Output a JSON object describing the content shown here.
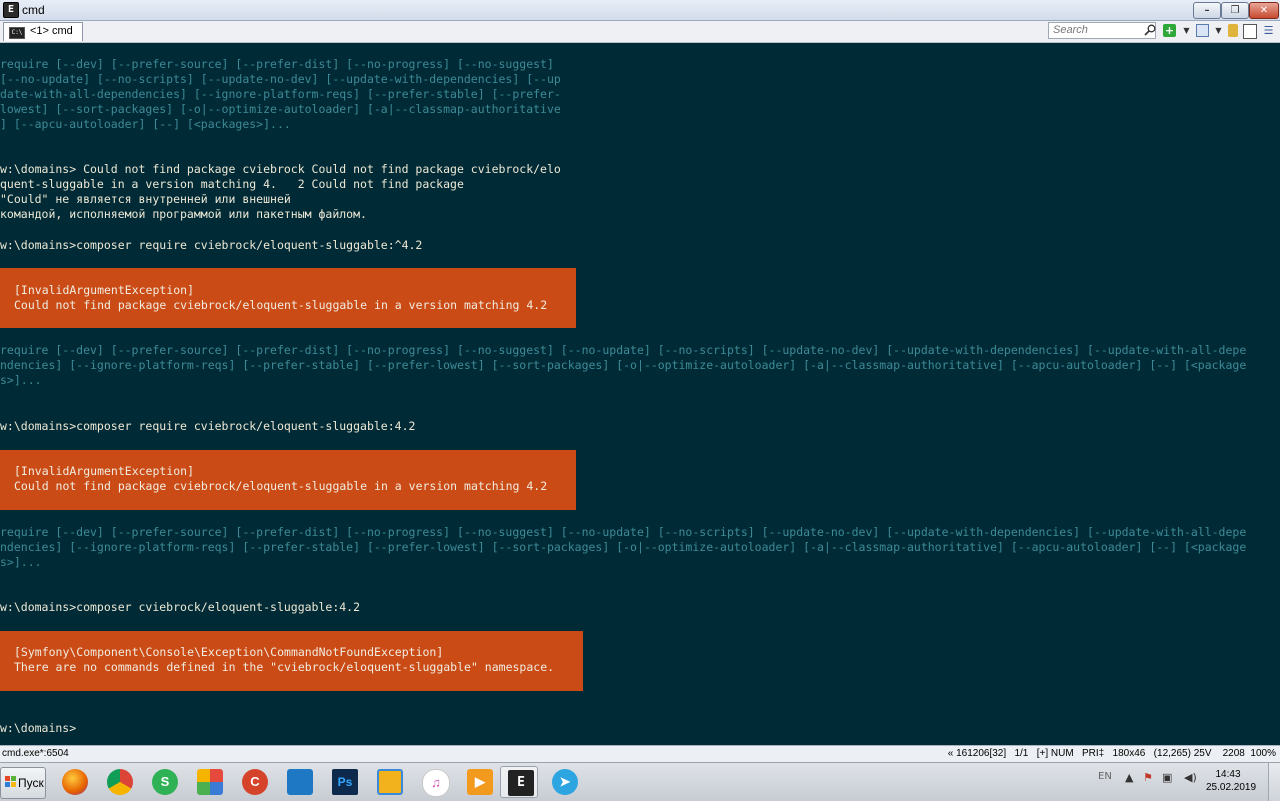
{
  "window": {
    "title": "cmd",
    "app_icon": "E",
    "minimize": "–",
    "maximize": "❐",
    "close": "✕"
  },
  "tabbar": {
    "tab_label": "<1> cmd",
    "search_placeholder": "Search",
    "search_icon": "magnifier-icon"
  },
  "console": {
    "lines": [
      {
        "text": "require [--dev] [--prefer-source] [--prefer-dist] [--no-progress] [--no-suggest]",
        "style": "help"
      },
      {
        "text": "[--no-update] [--no-scripts] [--update-no-dev] [--update-with-dependencies] [--up",
        "style": "help"
      },
      {
        "text": "date-with-all-dependencies] [--ignore-platform-reqs] [--prefer-stable] [--prefer-",
        "style": "help"
      },
      {
        "text": "lowest] [--sort-packages] [-o|--optimize-autoloader] [-a|--classmap-authoritative",
        "style": "help"
      },
      {
        "text": "] [--apcu-autoloader] [--] [<packages>]...",
        "style": "help"
      },
      {
        "text": "w:\\domains> Could not find package cviebrock Could not find package cviebrock/elo",
        "style": "normal"
      },
      {
        "text": "quent-sluggable in a version matching 4.   2 Could not find package",
        "style": "normal"
      },
      {
        "text": "\"Could\" не является внутренней или внешней",
        "style": "normal"
      },
      {
        "text": "командой, исполняемой программой или пакетным файлом.",
        "style": "normal"
      },
      {
        "text": "w:\\domains>composer require cviebrock/eloquent-sluggable:^4.2",
        "style": "normal"
      },
      {
        "text": "require [--dev] [--prefer-source] [--prefer-dist] [--no-progress] [--no-suggest] [--no-update] [--no-scripts] [--update-no-dev] [--update-with-dependencies] [--update-with-all-depe",
        "style": "help"
      },
      {
        "text": "ndencies] [--ignore-platform-reqs] [--prefer-stable] [--prefer-lowest] [--sort-packages] [-o|--optimize-autoloader] [-a|--classmap-authoritative] [--apcu-autoloader] [--] [<package",
        "style": "help"
      },
      {
        "text": "s>]...",
        "style": "help"
      },
      {
        "text": "w:\\domains>composer require cviebrock/eloquent-sluggable:4.2",
        "style": "normal"
      },
      {
        "text": "require [--dev] [--prefer-source] [--prefer-dist] [--no-progress] [--no-suggest] [--no-update] [--no-scripts] [--update-no-dev] [--update-with-dependencies] [--update-with-all-depe",
        "style": "help"
      },
      {
        "text": "ndencies] [--ignore-platform-reqs] [--prefer-stable] [--prefer-lowest] [--sort-packages] [-o|--optimize-autoloader] [-a|--classmap-authoritative] [--apcu-autoloader] [--] [<package",
        "style": "help"
      },
      {
        "text": "s>]...",
        "style": "help"
      },
      {
        "text": "w:\\domains>composer cviebrock/eloquent-sluggable:4.2",
        "style": "normal"
      },
      {
        "text": "w:\\domains>",
        "style": "normal"
      }
    ],
    "errors": [
      {
        "title": "[InvalidArgumentException]",
        "message": "Could not find package cviebrock/eloquent-sluggable in a version matching 4.2"
      },
      {
        "title": "[InvalidArgumentException]",
        "message": "Could not find package cviebrock/eloquent-sluggable in a version matching 4.2"
      },
      {
        "title": "[Symfony\\Component\\Console\\Exception\\CommandNotFoundException]",
        "message": "There are no commands defined in the \"cviebrock/eloquent-sluggable\" namespace."
      }
    ],
    "colors": {
      "background": "#002b36",
      "text": "#eee8d5",
      "help_text": "#3d8a96",
      "error_bg": "#cb4b16"
    }
  },
  "statusbar": {
    "process": "cmd.exe*:6504",
    "info": "« 161206[32]   1/1   [+] NUM   PRI‡   180x46   (12,265) 25V    2208  100%"
  },
  "taskbar": {
    "start_label": "Пуск",
    "apps": [
      {
        "name": "firefox-icon",
        "glyph": "",
        "color": "#e66000"
      },
      {
        "name": "chrome-icon",
        "glyph": "",
        "color": "#4285f4"
      },
      {
        "name": "skype-green-icon",
        "glyph": "S",
        "color": "#2fb155"
      },
      {
        "name": "app-grid-icon",
        "glyph": "",
        "color": "#4a6fb5"
      },
      {
        "name": "ccleaner-icon",
        "glyph": "C",
        "color": "#d5432b"
      },
      {
        "name": "vscode-icon",
        "glyph": "",
        "color": "#1f78c4"
      },
      {
        "name": "photoshop-icon",
        "glyph": "Ps",
        "color": "#0d2a4d"
      },
      {
        "name": "notes-icon",
        "glyph": "",
        "color": "#f2b21e"
      },
      {
        "name": "itunes-icon",
        "glyph": "♫",
        "color": "#d24fb5"
      },
      {
        "name": "media-player-icon",
        "glyph": "▶",
        "color": "#f29a1e"
      },
      {
        "name": "conemu-icon",
        "glyph": "E",
        "color": "#222222"
      },
      {
        "name": "telegram-icon",
        "glyph": "➤",
        "color": "#2ca5e0"
      }
    ],
    "lang": "EN",
    "time": "14:43",
    "date": "25.02.2019"
  }
}
